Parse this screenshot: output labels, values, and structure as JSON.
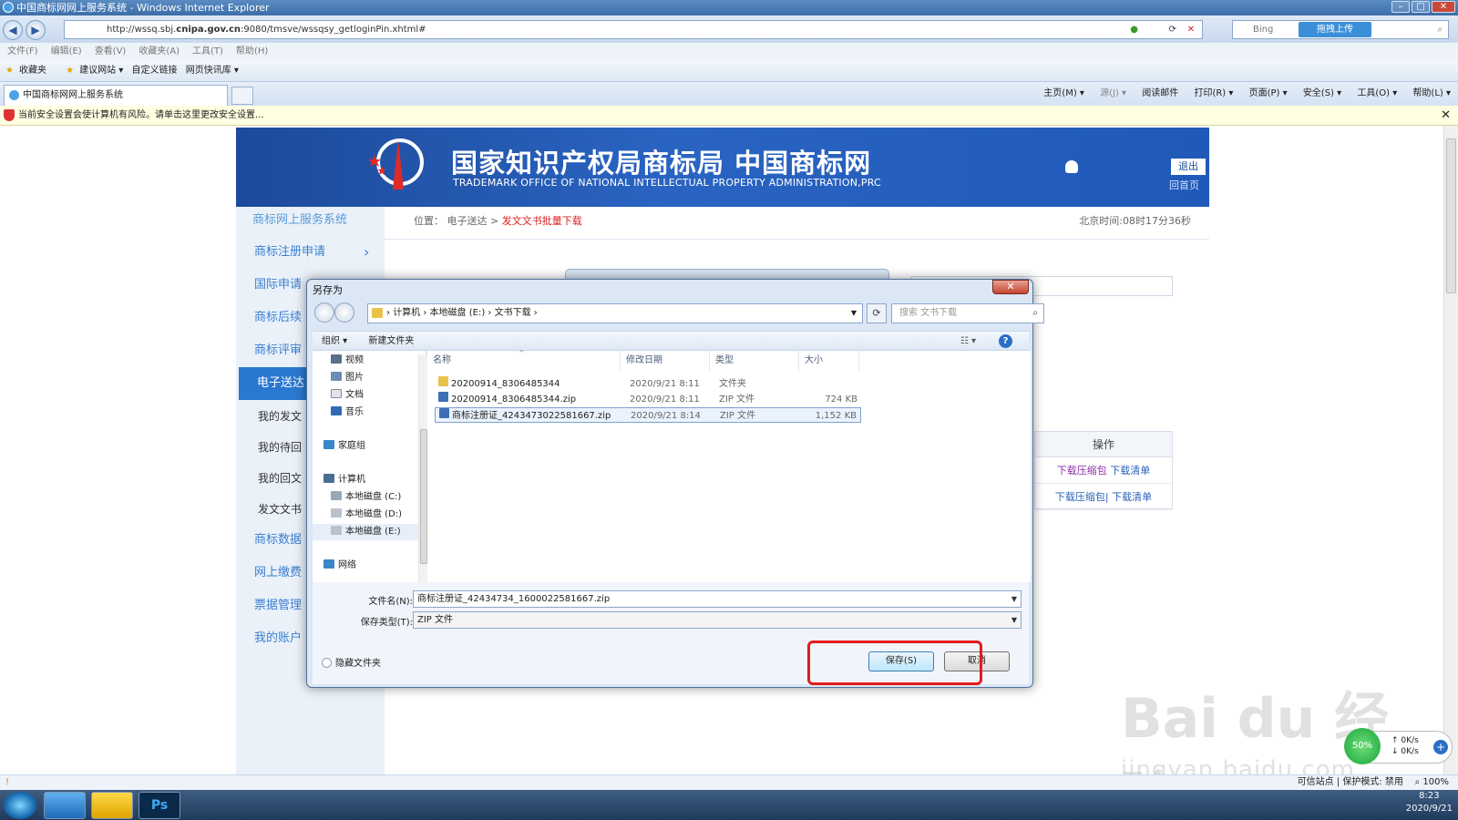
{
  "window": {
    "title": "中国商标网网上服务系统 - Windows Internet Explorer",
    "min": "–",
    "max": "□",
    "close": "✕"
  },
  "browser": {
    "url_prefix": "http://wssq.sbj.",
    "url_host": "cnipa.gov.cn",
    "url_rest": ":9080/tmsve/wssqsy_getloginPin.xhtml#",
    "search_placeholder": "Bing",
    "upload_label": "拖拽上传",
    "menu": [
      "文件(F)",
      "编辑(E)",
      "查看(V)",
      "收藏夹(A)",
      "工具(T)",
      "帮助(H)"
    ],
    "favorites": [
      "收藏夹",
      "建议网站 ▾",
      "自定义链接",
      "网页快讯库 ▾"
    ],
    "tab_title": "中国商标网网上服务系统",
    "commands": [
      "主页(M) ▾",
      "源(J) ▾",
      "阅读邮件",
      "打印(R) ▾",
      "页面(P) ▾",
      "安全(S) ▾",
      "工具(O) ▾",
      "帮助(L) ▾"
    ],
    "infobar": "当前安全设置会使计算机有风险。请单击这里更改安全设置...",
    "infobar_close": "✕",
    "status_right": "可信站点 | 保护模式: 禁用",
    "zoom": "100%"
  },
  "site": {
    "title_cn": "国家知识产权局商标局 中国商标网",
    "title_en": "TRADEMARK OFFICE OF NATIONAL INTELLECTUAL PROPERTY ADMINISTRATION,PRC",
    "logout": "退出",
    "home": "回首页",
    "system_name": "商标网上服务系统",
    "breadcrumb_prefix": "位置： 电子送达 >",
    "breadcrumb_current": "发文文书批量下载",
    "clock": "北京时间:08时17分36秒",
    "sidebar": [
      {
        "label": "商标注册申请",
        "arrow": "›"
      },
      {
        "label": "国际申请"
      },
      {
        "label": "商标后续"
      },
      {
        "label": "商标评审"
      },
      {
        "label": "电子送达"
      },
      {
        "label": "我的发文"
      },
      {
        "label": "我的待回"
      },
      {
        "label": "我的回文"
      },
      {
        "label": "发文文书"
      },
      {
        "label": "商标数据"
      },
      {
        "label": "网上缴费"
      },
      {
        "label": "票据管理"
      },
      {
        "label": "我的账户"
      }
    ],
    "ops_header": "操作",
    "ops_rows": [
      {
        "a": "下载压缩包",
        "b": "下载清单"
      },
      {
        "a": "下载压缩包|",
        "b": "下载清单"
      }
    ]
  },
  "dialog": {
    "title": "另存为",
    "close": "✕",
    "path": [
      "计算机",
      "本地磁盘 (E:)",
      "文书下载"
    ],
    "search_placeholder": "搜索 文书下载",
    "organize": "组织 ▾",
    "new_folder": "新建文件夹",
    "view": "☷ ▾",
    "help": "?",
    "tree": [
      {
        "label": "视频",
        "color": "#5a6f8a"
      },
      {
        "label": "图片",
        "color": "#6b8db5"
      },
      {
        "label": "文档",
        "color": "#dde4ee"
      },
      {
        "label": "音乐",
        "color": "#2f6bb5"
      },
      {
        "label": "家庭组",
        "color": "#3a86c8"
      },
      {
        "label": "计算机",
        "color": "#4a6d94"
      },
      {
        "label": "本地磁盘 (C:)",
        "color": "#9aa7b5"
      },
      {
        "label": "本地磁盘 (D:)",
        "color": "#b9c2cc"
      },
      {
        "label": "本地磁盘 (E:)",
        "color": "#b9c2cc"
      },
      {
        "label": "网络",
        "color": "#3a86c8"
      }
    ],
    "columns": [
      "名称",
      "修改日期",
      "类型",
      "大小"
    ],
    "files": [
      {
        "name": "20200914_8306485344",
        "date": "2020/9/21 8:11",
        "type": "文件夹",
        "size": "",
        "icon": "#e8c24b"
      },
      {
        "name": "20200914_8306485344.zip",
        "date": "2020/9/21 8:11",
        "type": "ZIP 文件",
        "size": "724 KB",
        "icon": "#3c6fb6"
      },
      {
        "name": "商标注册证_4243473022581667.zip",
        "date": "2020/9/21 8:14",
        "type": "ZIP 文件",
        "size": "1,152 KB",
        "icon": "#3c6fb6"
      }
    ],
    "filename_label": "文件名(N):",
    "filename_value": "商标注册证_42434734_1600022581667.zip",
    "filetype_label": "保存类型(T):",
    "filetype_value": "ZIP 文件",
    "hide_folders": "隐藏文件夹",
    "save": "保存(S)",
    "cancel": "取消"
  },
  "taskbar": {
    "time": "8:23",
    "date": "2020/9/21"
  },
  "watermark": {
    "main": "Bai du 经验",
    "sub": "jingyan.baidu.com"
  },
  "netwidget": {
    "percent": "50%",
    "up": "0K/s",
    "down": "0K/s",
    "plus": "+"
  }
}
